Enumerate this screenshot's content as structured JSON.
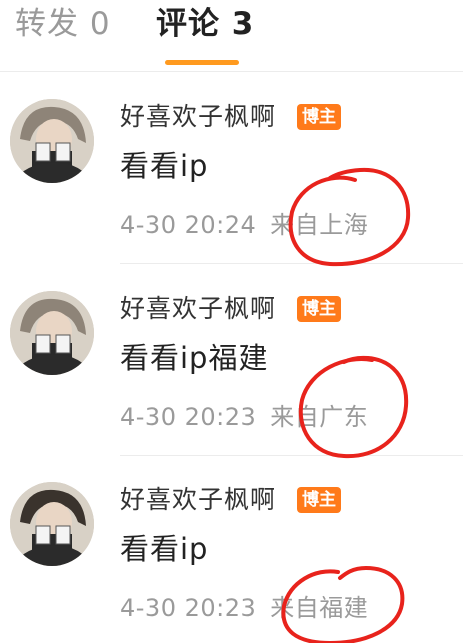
{
  "tabs": {
    "repost_label": "转发 0",
    "comments_label": "评论 3"
  },
  "colors": {
    "accent": "#ff9a1f",
    "badge": "#ff7a1a",
    "annotation": "#e8231c"
  },
  "comments": [
    {
      "username": "好喜欢子枫啊",
      "badge": "博主",
      "text": "看看ip",
      "time": "4-30 20:24",
      "location": "来自上海"
    },
    {
      "username": "好喜欢子枫啊",
      "badge": "博主",
      "text": "看看ip福建",
      "time": "4-30 20:23",
      "location": "来自广东"
    },
    {
      "username": "好喜欢子枫啊",
      "badge": "博主",
      "text": "看看ip",
      "time": "4-30 20:23",
      "location": "来自福建"
    }
  ]
}
